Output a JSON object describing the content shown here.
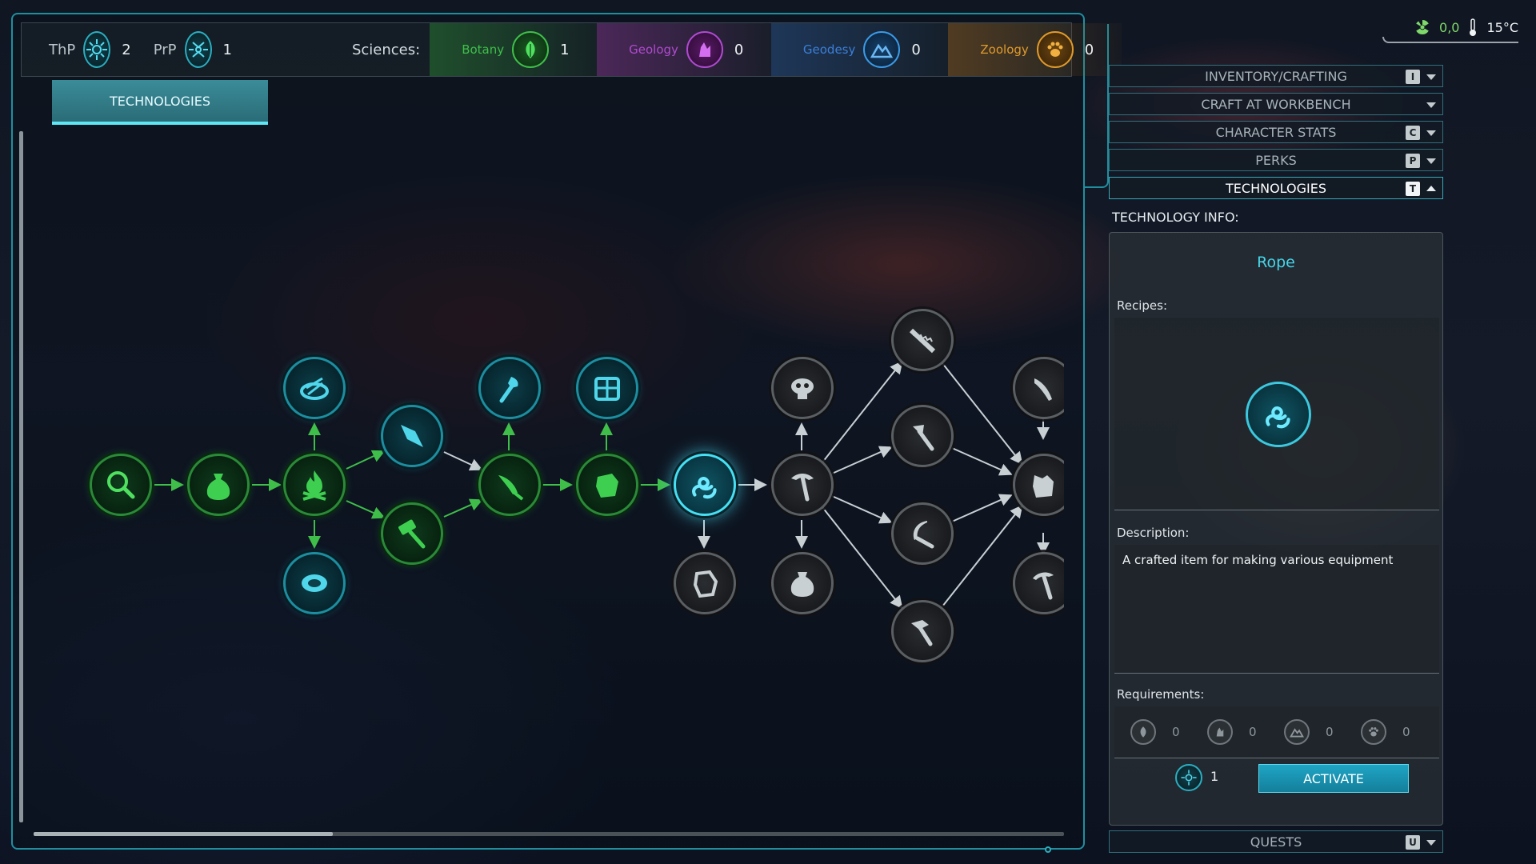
{
  "points": {
    "thp_label": "ThP",
    "thp_value": "2",
    "prp_label": "PrP",
    "prp_value": "1"
  },
  "sciences": {
    "label": "Sciences:",
    "items": [
      {
        "name": "Botany",
        "value": "1",
        "color": "#3fbf4a",
        "icon": "leaf-icon"
      },
      {
        "name": "Geology",
        "value": "0",
        "color": "#b04ad0",
        "icon": "crystal-icon"
      },
      {
        "name": "Geodesy",
        "value": "0",
        "color": "#3a7fd8",
        "icon": "mountain-icon"
      },
      {
        "name": "Zoology",
        "value": "0",
        "color": "#e09a2a",
        "icon": "paw-icon"
      }
    ]
  },
  "tab": {
    "label": "TECHNOLOGIES"
  },
  "status": {
    "radiation": "0,0",
    "temperature": "15°C"
  },
  "menu": [
    {
      "label": "INVENTORY/CRAFTING",
      "key": "I"
    },
    {
      "label": "CRAFT AT WORKBENCH",
      "key": ""
    },
    {
      "label": "CHARACTER STATS",
      "key": "C"
    },
    {
      "label": "PERKS",
      "key": "P"
    },
    {
      "label": "TECHNOLOGIES",
      "key": "T"
    },
    {
      "label": "QUESTS",
      "key": "U"
    }
  ],
  "info": {
    "title": "TECHNOLOGY INFO:",
    "tech_name": "Rope",
    "recipes_label": "Recipes:",
    "description_label": "Description:",
    "description": "A crafted item for making various equipment",
    "requirements_label": "Requirements:",
    "requirements": [
      {
        "icon": "leaf-icon",
        "value": "0"
      },
      {
        "icon": "crystal-icon",
        "value": "0"
      },
      {
        "icon": "mountain-icon",
        "value": "0"
      },
      {
        "icon": "paw-icon",
        "value": "0"
      }
    ],
    "cost": "1",
    "activate_label": "ACTIVATE"
  },
  "accent_colors": {
    "teal": "#46e0f4",
    "green": "#2a8a38",
    "locked": "#5a5f64"
  }
}
